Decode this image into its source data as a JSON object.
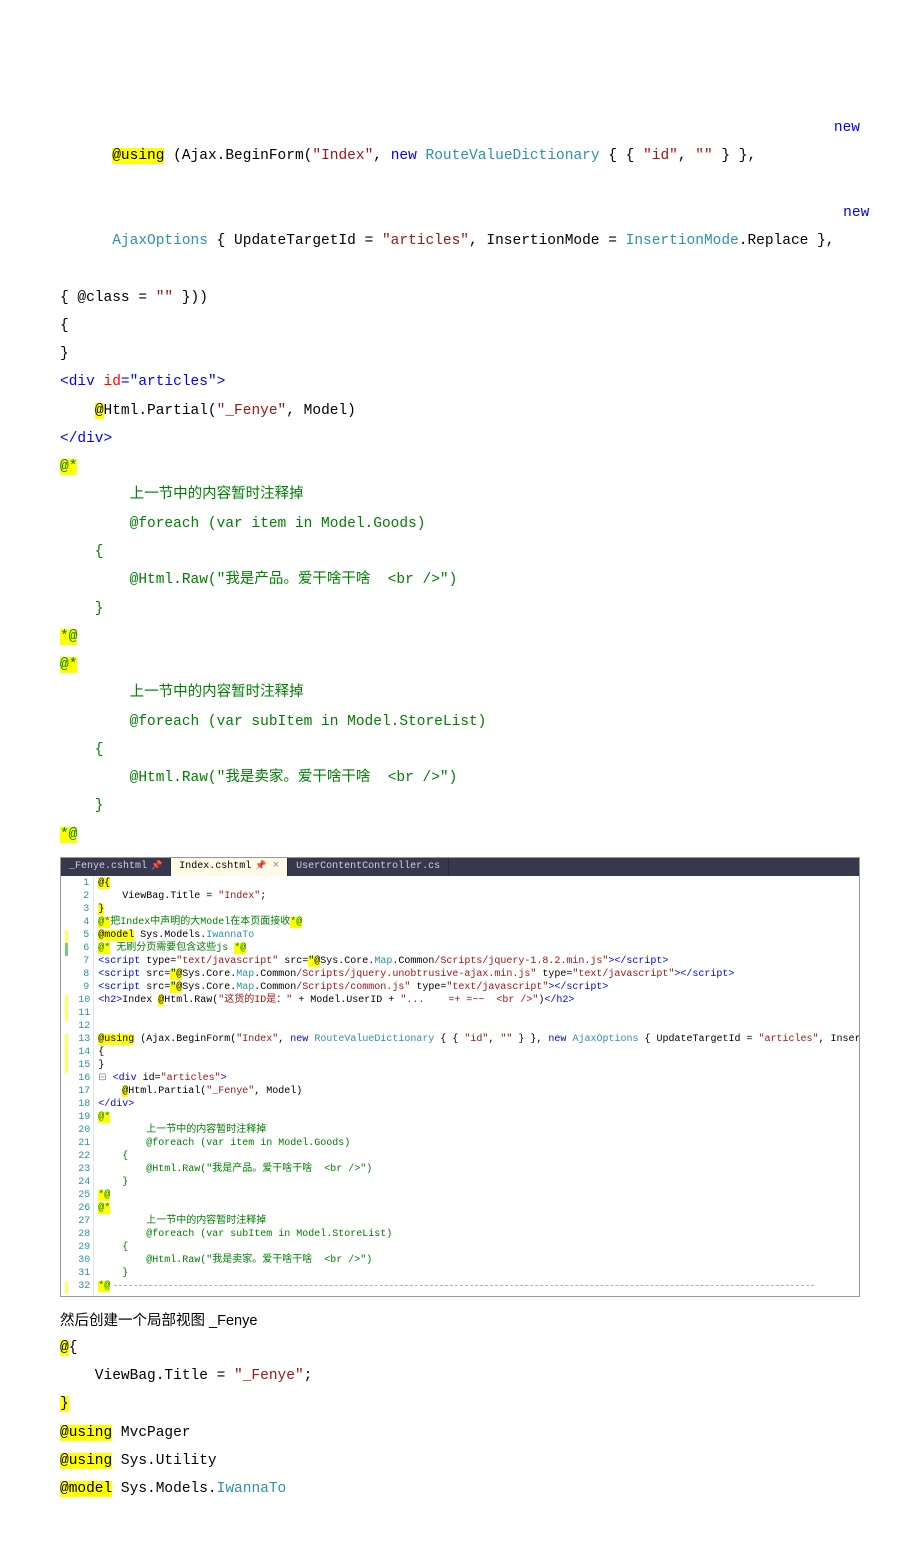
{
  "block1": {
    "l1_using": "@using",
    "l1_rest1": " (Ajax.BeginForm(",
    "l1_q1": "\"Index\"",
    "l1_rest2": ", ",
    "l1_new": "new",
    "l1_rest3": " ",
    "l1_rvd": "RouteValueDictionary",
    "l1_rest4": " { { ",
    "l1_q2": "\"id\"",
    "l1_rest5": ", ",
    "l1_q3": "\"\"",
    "l1_rest6": " } }, ",
    "l1_newb": "new",
    "l2_ajaxopt": "AjaxOptions",
    "l2_rest1": " { UpdateTargetId = ",
    "l2_q1": "\"articles\"",
    "l2_rest2": ", InsertionMode = ",
    "l2_insmode": "InsertionMode",
    "l2_rest3": ".Replace }, ",
    "l2_new": "new",
    "l3_pre": "{ @class = ",
    "l3_q": "\"\"",
    "l3_post": " }))",
    "l4": "{",
    "l5": "}",
    "l6_open": "<div",
    "l6_attr": " id",
    "l6_eq": "=",
    "l6_val": "\"articles\"",
    "l6_close": ">",
    "l7_at": "@",
    "l7_rest": "Html.Partial(",
    "l7_q": "\"_Fenye\"",
    "l7_post": ", Model)",
    "l8_close": "</div>",
    "l9_at": "@*",
    "l10": "        上一节中的内容暂时注释掉",
    "l11": "        @foreach (var item in Model.Goods)",
    "l12": "    {",
    "l13": "        @Html.Raw(\"我是产品。爱干啥干啥  <br />\")",
    "l14": "    }",
    "l15_at": "*@",
    "l16_at": "@*",
    "l17": "        上一节中的内容暂时注释掉",
    "l18": "        @foreach (var subItem in Model.StoreList)",
    "l19": "    {",
    "l20": "        @Html.Raw(\"我是卖家。爱干啥干啥  <br />\")",
    "l21": "    }",
    "l22_at": "*@"
  },
  "body_text": "然后创建一个局部视图 _Fenye",
  "block2": {
    "l1_at": "@",
    "l1_rest": "{",
    "l2": "    ViewBag.Title = ",
    "l2_q": "\"_Fenye\"",
    "l2_semi": ";",
    "l3_at": "}",
    "l4_at": "@using",
    "l4_rest": " MvcPager",
    "l5_at": "@using",
    "l5_rest": " Sys.Utility",
    "l6_at": "@model",
    "l6_rest": " Sys.Models.",
    "l6_type": "IwannaTo"
  },
  "ide": {
    "tabs": [
      {
        "label": "_Fenye.cshtml",
        "active": false,
        "pinned": true
      },
      {
        "label": "Index.cshtml",
        "active": true,
        "pinned": true,
        "closeable": true
      },
      {
        "label": "UserContentController.cs",
        "active": false
      }
    ],
    "lines": [
      {
        "n": 1,
        "m": "",
        "frags": [
          {
            "t": "@{",
            "c": "c-hl c-black"
          }
        ]
      },
      {
        "n": 2,
        "m": "",
        "frags": [
          {
            "t": "    ViewBag.Title = ",
            "c": "c-black"
          },
          {
            "t": "\"Index\"",
            "c": "c-str"
          },
          {
            "t": ";",
            "c": "c-black"
          }
        ]
      },
      {
        "n": 3,
        "m": "",
        "frags": [
          {
            "t": "}",
            "c": "c-hl c-black"
          }
        ]
      },
      {
        "n": 4,
        "m": "",
        "frags": [
          {
            "t": "@*",
            "c": "c-hl c-green"
          },
          {
            "t": "把Index中声明的大Model在本页面接收",
            "c": "c-green"
          },
          {
            "t": "*@",
            "c": "c-hl c-green"
          }
        ]
      },
      {
        "n": 5,
        "m": "y",
        "frags": [
          {
            "t": "@model",
            "c": "c-hl c-black"
          },
          {
            "t": " Sys.Models.",
            "c": "c-black"
          },
          {
            "t": "IwannaTo",
            "c": "c-type"
          }
        ]
      },
      {
        "n": 6,
        "m": "g",
        "frags": [
          {
            "t": "@*",
            "c": "c-hl c-green"
          },
          {
            "t": " 无刷分页需要包含这些js ",
            "c": "c-green"
          },
          {
            "t": "*@",
            "c": "c-hl c-green"
          }
        ]
      },
      {
        "n": 7,
        "m": "",
        "frags": [
          {
            "t": "<script ",
            "c": "c-blue"
          },
          {
            "t": "type=",
            "c": "c-black"
          },
          {
            "t": "\"text/javascript\"",
            "c": "c-str"
          },
          {
            "t": " src=",
            "c": "c-black"
          },
          {
            "t": "\"@",
            "c": "c-hl c-black"
          },
          {
            "t": "Sys.Core.",
            "c": "c-black"
          },
          {
            "t": "Map",
            "c": "c-type"
          },
          {
            "t": ".Common",
            "c": "c-black"
          },
          {
            "t": "/Scripts/jquery-1.8.2.min.js\"",
            "c": "c-str"
          },
          {
            "t": "></script>",
            "c": "c-blue"
          }
        ]
      },
      {
        "n": 8,
        "m": "",
        "frags": [
          {
            "t": "<script ",
            "c": "c-blue"
          },
          {
            "t": "src=",
            "c": "c-black"
          },
          {
            "t": "\"@",
            "c": "c-hl c-black"
          },
          {
            "t": "Sys.Core.",
            "c": "c-black"
          },
          {
            "t": "Map",
            "c": "c-type"
          },
          {
            "t": ".Common",
            "c": "c-black"
          },
          {
            "t": "/Scripts/jquery.unobtrusive-ajax.min.js\"",
            "c": "c-str"
          },
          {
            "t": " type=",
            "c": "c-black"
          },
          {
            "t": "\"text/javascript\"",
            "c": "c-str"
          },
          {
            "t": "></script>",
            "c": "c-blue"
          }
        ]
      },
      {
        "n": 9,
        "m": "",
        "frags": [
          {
            "t": "<script ",
            "c": "c-blue"
          },
          {
            "t": "src=",
            "c": "c-black"
          },
          {
            "t": "\"@",
            "c": "c-hl c-black"
          },
          {
            "t": "Sys.Core.",
            "c": "c-black"
          },
          {
            "t": "Map",
            "c": "c-type"
          },
          {
            "t": ".Common",
            "c": "c-black"
          },
          {
            "t": "/Scripts/common.js\"",
            "c": "c-str"
          },
          {
            "t": " type=",
            "c": "c-black"
          },
          {
            "t": "\"text/javascript\"",
            "c": "c-str"
          },
          {
            "t": "></script>",
            "c": "c-blue"
          }
        ]
      },
      {
        "n": 10,
        "m": "y",
        "frags": [
          {
            "t": "<h2>",
            "c": "c-blue"
          },
          {
            "t": "Index ",
            "c": "c-black"
          },
          {
            "t": "@",
            "c": "c-hl c-black"
          },
          {
            "t": "Html.Raw(",
            "c": "c-black"
          },
          {
            "t": "\"这货的ID是：\"",
            "c": "c-str"
          },
          {
            "t": " + Model.UserID + ",
            "c": "c-black"
          },
          {
            "t": "\"...    =+ =~~  <br />\"",
            "c": "c-str"
          },
          {
            "t": ")",
            "c": "c-black"
          },
          {
            "t": "</h2>",
            "c": "c-blue"
          }
        ]
      },
      {
        "n": 11,
        "m": "y",
        "frags": [
          {
            "t": "",
            "c": "c-black"
          }
        ]
      },
      {
        "n": 12,
        "m": "",
        "frags": [
          {
            "t": "",
            "c": "c-black"
          }
        ]
      },
      {
        "n": 13,
        "m": "y",
        "frags": [
          {
            "t": "@using",
            "c": "c-hl c-black"
          },
          {
            "t": " (Ajax.BeginForm(",
            "c": "c-black"
          },
          {
            "t": "\"Index\"",
            "c": "c-str"
          },
          {
            "t": ", ",
            "c": "c-black"
          },
          {
            "t": "new",
            "c": "c-blue"
          },
          {
            "t": " ",
            "c": "c-black"
          },
          {
            "t": "RouteValueDictionary",
            "c": "c-type"
          },
          {
            "t": " { { ",
            "c": "c-black"
          },
          {
            "t": "\"id\"",
            "c": "c-str"
          },
          {
            "t": ", ",
            "c": "c-black"
          },
          {
            "t": "\"\"",
            "c": "c-str"
          },
          {
            "t": " } }, ",
            "c": "c-black"
          },
          {
            "t": "new",
            "c": "c-blue"
          },
          {
            "t": " ",
            "c": "c-black"
          },
          {
            "t": "AjaxOptions",
            "c": "c-type"
          },
          {
            "t": " { UpdateTargetId = ",
            "c": "c-black"
          },
          {
            "t": "\"articles\"",
            "c": "c-str"
          },
          {
            "t": ", InsertionMode = In",
            "c": "c-black"
          }
        ]
      },
      {
        "n": 14,
        "m": "y",
        "frags": [
          {
            "t": "{",
            "c": "c-black"
          }
        ]
      },
      {
        "n": 15,
        "m": "y",
        "frags": [
          {
            "t": "}",
            "c": "c-black"
          }
        ]
      },
      {
        "n": 16,
        "m": "",
        "frags": [
          {
            "t": "<div ",
            "c": "c-blue"
          },
          {
            "t": "id=",
            "c": "c-black"
          },
          {
            "t": "\"articles\"",
            "c": "c-str"
          },
          {
            "t": ">",
            "c": "c-blue"
          }
        ],
        "collapse": "-"
      },
      {
        "n": 17,
        "m": "",
        "frags": [
          {
            "t": "    ",
            "c": "c-black"
          },
          {
            "t": "@",
            "c": "c-hl c-black"
          },
          {
            "t": "Html.Partial(",
            "c": "c-black"
          },
          {
            "t": "\"_Fenye\"",
            "c": "c-str"
          },
          {
            "t": ", Model)",
            "c": "c-black"
          }
        ]
      },
      {
        "n": 18,
        "m": "",
        "frags": [
          {
            "t": "</div>",
            "c": "c-blue"
          }
        ]
      },
      {
        "n": 19,
        "m": "",
        "frags": [
          {
            "t": "@*",
            "c": "c-hl c-green"
          }
        ]
      },
      {
        "n": 20,
        "m": "",
        "frags": [
          {
            "t": "        上一节中的内容暂时注释掉",
            "c": "c-green"
          }
        ]
      },
      {
        "n": 21,
        "m": "",
        "frags": [
          {
            "t": "        @foreach (var item in Model.Goods)",
            "c": "c-green"
          }
        ]
      },
      {
        "n": 22,
        "m": "",
        "frags": [
          {
            "t": "    {",
            "c": "c-green"
          }
        ]
      },
      {
        "n": 23,
        "m": "",
        "frags": [
          {
            "t": "        @Html.Raw(\"我是产品。爱干啥干啥  <br />\")",
            "c": "c-green"
          }
        ]
      },
      {
        "n": 24,
        "m": "",
        "frags": [
          {
            "t": "    }",
            "c": "c-green"
          }
        ]
      },
      {
        "n": 25,
        "m": "",
        "frags": [
          {
            "t": "*@",
            "c": "c-hl c-green"
          }
        ]
      },
      {
        "n": 26,
        "m": "",
        "frags": [
          {
            "t": "@*",
            "c": "c-hl c-green"
          }
        ]
      },
      {
        "n": 27,
        "m": "",
        "frags": [
          {
            "t": "        上一节中的内容暂时注释掉",
            "c": "c-green"
          }
        ]
      },
      {
        "n": 28,
        "m": "",
        "frags": [
          {
            "t": "        @foreach (var subItem in Model.StoreList)",
            "c": "c-green"
          }
        ]
      },
      {
        "n": 29,
        "m": "",
        "frags": [
          {
            "t": "    {",
            "c": "c-green"
          }
        ]
      },
      {
        "n": 30,
        "m": "",
        "frags": [
          {
            "t": "        @Html.Raw(\"我是卖家。爱干啥干啥  <br />\")",
            "c": "c-green"
          }
        ]
      },
      {
        "n": 31,
        "m": "",
        "frags": [
          {
            "t": "    }",
            "c": "c-green"
          }
        ]
      },
      {
        "n": 32,
        "m": "y",
        "frags": [
          {
            "t": "*@",
            "c": "c-hl c-green"
          }
        ],
        "dash": true
      }
    ]
  }
}
